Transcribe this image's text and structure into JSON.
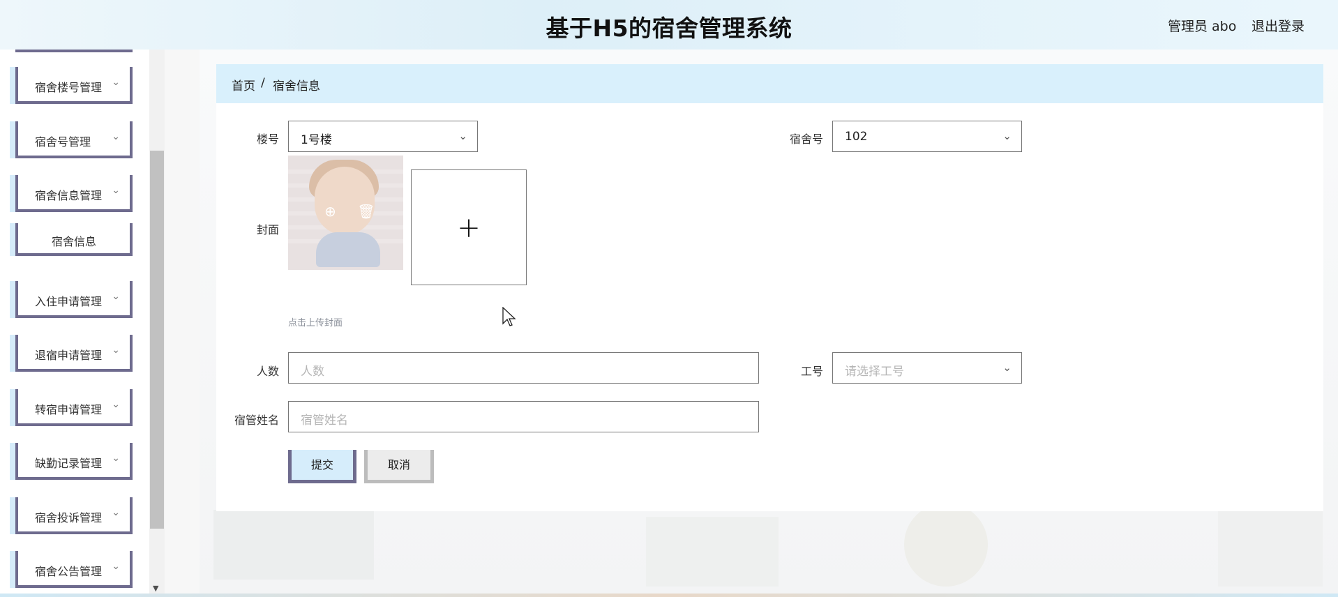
{
  "header": {
    "title": "基于H5的宿舍管理系统",
    "admin": "管理员 abo",
    "logout": "退出登录"
  },
  "sidebar": {
    "items": [
      {
        "label": "宿舍楼号管理",
        "chev": "⌄"
      },
      {
        "label": "宿舍号管理",
        "chev": "⌄"
      },
      {
        "label": "宿舍信息管理",
        "chev": "⌄"
      },
      {
        "label": "宿舍信息"
      },
      {
        "label": "入住申请管理",
        "chev": "⌄"
      },
      {
        "label": "退宿申请管理",
        "chev": "⌄"
      },
      {
        "label": "转宿申请管理",
        "chev": "⌄"
      },
      {
        "label": "缺勤记录管理",
        "chev": "⌄"
      },
      {
        "label": "宿舍投诉管理",
        "chev": "⌄"
      },
      {
        "label": "宿舍公告管理",
        "chev": "⌄"
      }
    ],
    "scroll_down": "▼"
  },
  "breadcrumb": {
    "home": "首页",
    "separator": "/",
    "current": "宿舍信息"
  },
  "form": {
    "building_label": "楼号",
    "building_value": "1号楼",
    "room_label": "宿舍号",
    "room_value": "102",
    "cover_label": "封面",
    "cover_icons": "⊕ 🗑",
    "upload_plus": "+",
    "upload_hint": "点击上传封面",
    "count_label": "人数",
    "count_placeholder": "人数",
    "staff_label": "工号",
    "staff_placeholder": "请选择工号",
    "manager_label": "宿管姓名",
    "manager_placeholder": "宿管姓名",
    "chev": "⌄",
    "submit": "提交",
    "cancel": "取消"
  }
}
